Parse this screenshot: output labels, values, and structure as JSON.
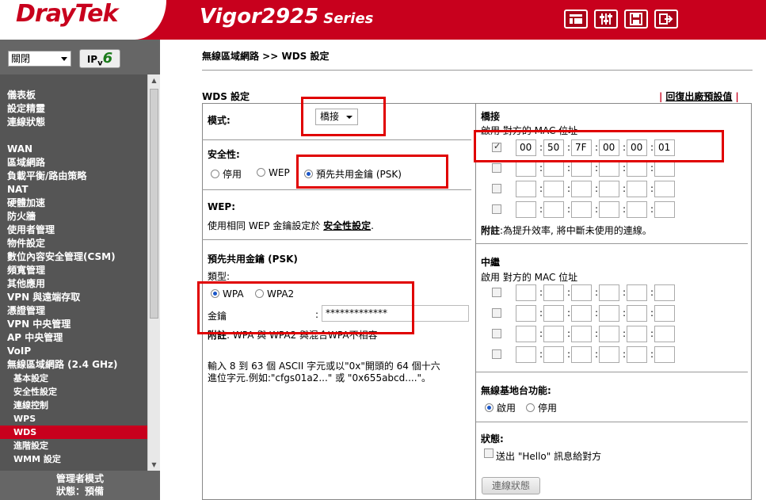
{
  "header": {
    "logo": "DrayTek",
    "model": "Vigor2925",
    "series": "Series",
    "icons": [
      "toolbar-menu-icon",
      "settings-sliders-icon",
      "save-disk-icon",
      "logout-icon"
    ]
  },
  "sidebar": {
    "language": "關閉",
    "ipv6_prefix": "IP",
    "ipv6_suffix": "v",
    "ipv6_six": "6",
    "group1": [
      "儀表板",
      "設定精靈",
      "連線狀態"
    ],
    "group2": [
      "WAN",
      "區域網路",
      "負載平衡/路由策略",
      "NAT",
      "硬體加速",
      "防火牆",
      "使用者管理",
      "物件設定",
      "數位內容安全管理(CSM)",
      "頻寬管理",
      "其他應用",
      "VPN 與遠端存取",
      "憑證管理",
      "VPN 中央管理",
      "AP 中央管理",
      "VoIP",
      "無線區域網路 (2.4 GHz)"
    ],
    "submenu": [
      "基本設定",
      "安全性設定",
      "連線控制",
      "WPS",
      "WDS",
      "進階設定",
      "WMM 設定"
    ],
    "active": "WDS",
    "footer_mode": "管理者模式",
    "footer_status": "狀態：預備"
  },
  "main": {
    "breadcrumb": "無線區域網路 >> WDS 設定",
    "section_title": "WDS 設定",
    "reset_link": "回復出廠預設值",
    "mode_label": "模式:",
    "mode_value": "橋接",
    "security_label": "安全性:",
    "security_options": [
      "停用",
      "WEP",
      "預先共用金鑰 (PSK)"
    ],
    "security_selected": "預先共用金鑰 (PSK)",
    "wep_title": "WEP:",
    "wep_text_prefix": "使用相同 WEP 金鑰設定於",
    "wep_link": "安全性設定",
    "wep_text_suffix": ".",
    "psk_title": "預先共用金鑰 (PSK)",
    "type_label": "類型:",
    "type_options": [
      "WPA",
      "WPA2"
    ],
    "type_selected": "WPA",
    "key_label": "金鑰",
    "key_colon": ":",
    "key_value": "*************",
    "note_label": "附註",
    "note_text": ": WPA 與 WPA2 與混合WPA不相容",
    "hint_line1": "輸入 8 到 63 個 ASCII 字元或以\"0x\"開頭的 64 個十六",
    "hint_line2": "進位字元.例如:\"cfgs01a2...\" 或 \"0x655abcd....\"。"
  },
  "bridge": {
    "title": "橋接",
    "header": "啟用 對方的 MAC 位址",
    "rows": [
      {
        "enabled": true,
        "mac": [
          "00",
          "50",
          "7F",
          "00",
          "00",
          "01"
        ]
      },
      {
        "enabled": false,
        "mac": [
          "",
          "",
          "",
          "",
          "",
          ""
        ]
      },
      {
        "enabled": false,
        "mac": [
          "",
          "",
          "",
          "",
          "",
          ""
        ]
      },
      {
        "enabled": false,
        "mac": [
          "",
          "",
          "",
          "",
          "",
          ""
        ]
      }
    ],
    "note_label": "附註",
    "note_text": ":為提升效率, 將中斷未使用的連線。"
  },
  "repeater": {
    "title": "中繼",
    "header": "啟用 對方的 MAC 位址"
  },
  "ap_function": {
    "title": "無線基地台功能:",
    "options": [
      "啟用",
      "停用"
    ],
    "selected": "啟用"
  },
  "status": {
    "title": "狀態:",
    "hello_label": "送出 \"Hello\" 訊息給對方",
    "button": "連線狀態"
  },
  "colors": {
    "brand_red": "#c8001d",
    "sidebar_bg": "#555555",
    "highlight_box": "#e00000"
  }
}
